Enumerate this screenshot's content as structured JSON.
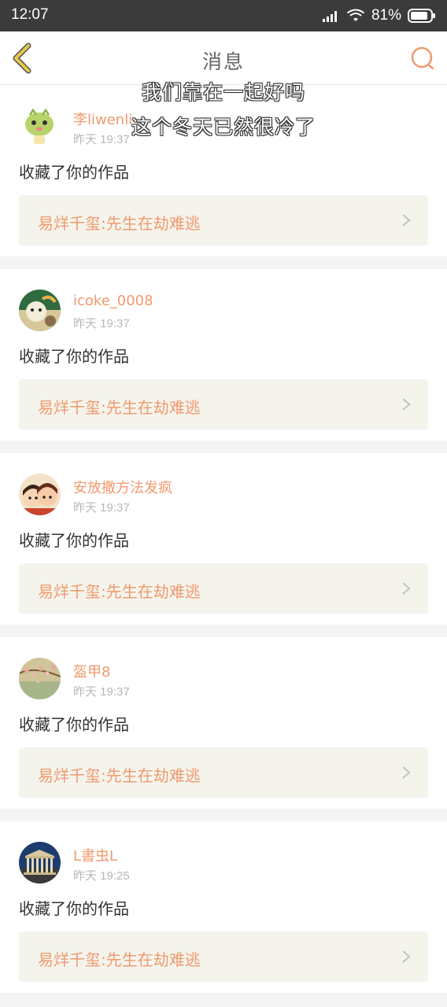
{
  "status_bar": {
    "time": "12:07",
    "battery": "81%"
  },
  "nav": {
    "title": "消息"
  },
  "overlay_lyrics": [
    "我们靠在一起好吗",
    "这个冬天已然很冷了"
  ],
  "messages": [
    {
      "username": "李liwenli",
      "time": "昨天 19:37",
      "action": "收藏了你的作品",
      "work": "易烊千玺:先生在劫难逃",
      "avatar": "green-cartoon-avatar"
    },
    {
      "username": "icoke_0008",
      "time": "昨天 19:37",
      "action": "收藏了你的作品",
      "work": "易烊千玺:先生在劫难逃",
      "avatar": "cartoon-avatar"
    },
    {
      "username": "安放撒方法发疯",
      "time": "昨天 19:37",
      "action": "收藏了你的作品",
      "work": "易烊千玺:先生在劫难逃",
      "avatar": "cartoon-couple-avatar"
    },
    {
      "username": "盔甲8",
      "time": "昨天 19:37",
      "action": "收藏了你的作品",
      "work": "易烊千玺:先生在劫难逃",
      "avatar": "blossom-avatar"
    },
    {
      "username": "L書虫L",
      "time": "昨天 19:25",
      "action": "收藏了你的作品",
      "work": "易烊千玺:先生在劫难逃",
      "avatar": "temple-avatar"
    }
  ],
  "colors": {
    "accent": "#f09a6e",
    "back_arrow": "#e8c84a",
    "status_bar": "#3b3b3b"
  }
}
